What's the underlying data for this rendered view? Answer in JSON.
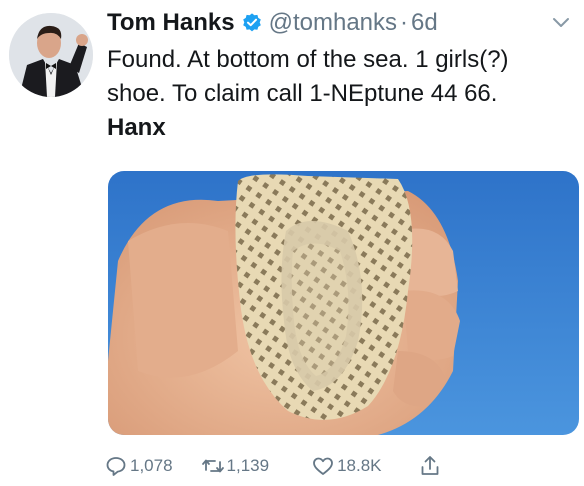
{
  "tweet": {
    "author_name": "Tom Hanks",
    "author_handle": "@tomhanks",
    "separator": "·",
    "age": "6d",
    "text": "Found. At bottom of the sea. 1 girls(?) shoe. To claim call 1-NEptune 44 66.",
    "signature": "Hanx"
  },
  "actions": {
    "replies": "1,078",
    "retweets": "1,139",
    "likes": "18.8K"
  },
  "colors": {
    "verified": "#1da1f2",
    "secondary_text": "#657786",
    "sky": "#3b7fd0"
  },
  "icons": {
    "verified": "verified-badge-icon",
    "more": "chevron-down-icon",
    "reply": "reply-icon",
    "retweet": "retweet-icon",
    "like": "heart-icon",
    "share": "share-icon"
  }
}
